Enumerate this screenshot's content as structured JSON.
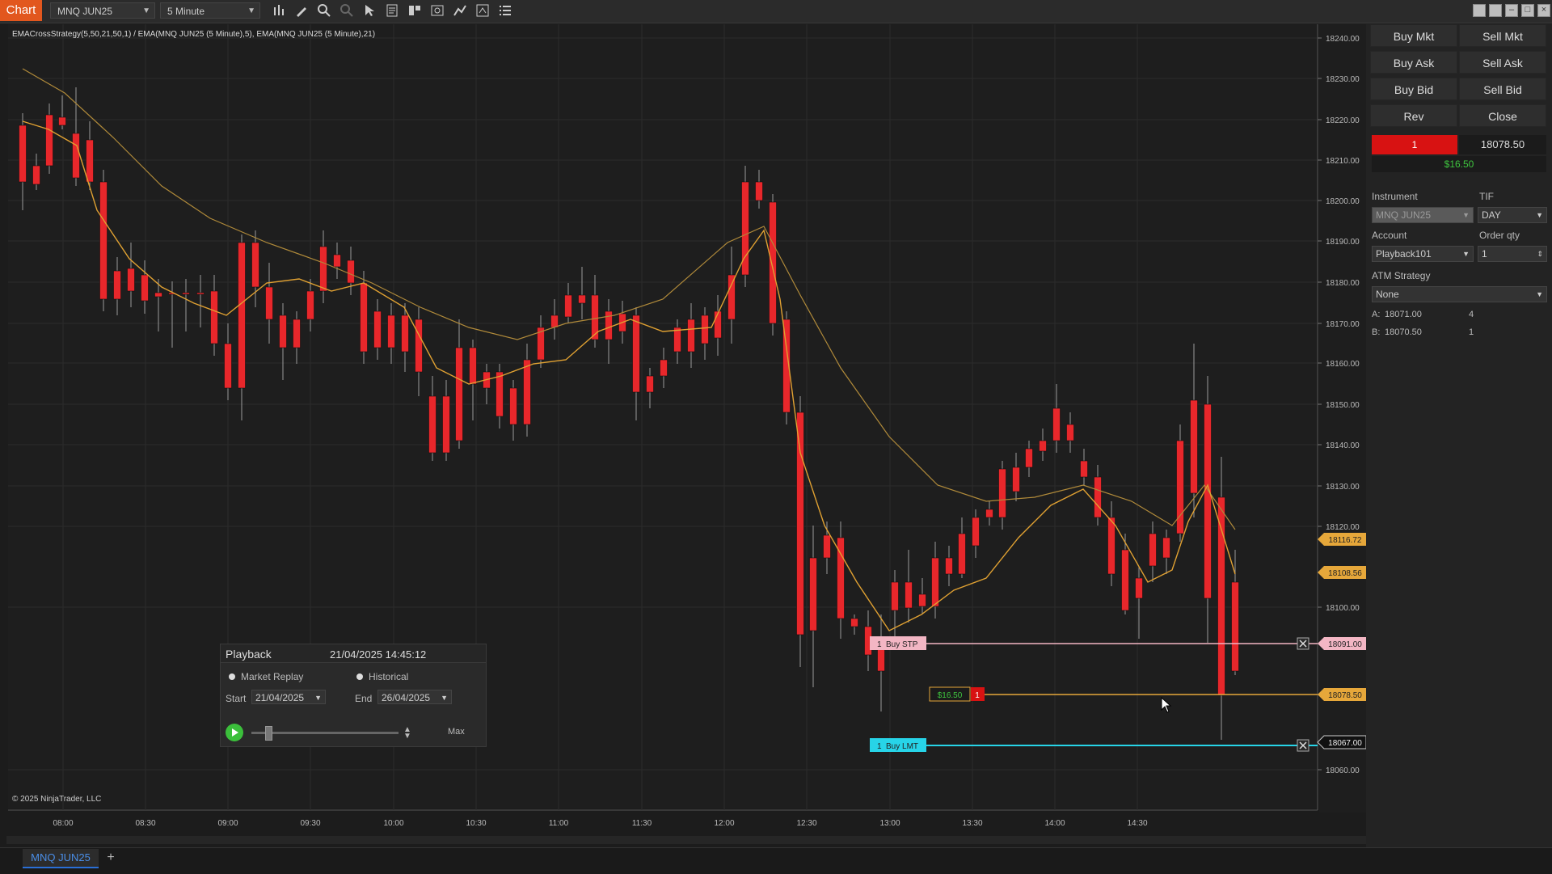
{
  "toolbar": {
    "chart_tab": "Chart",
    "instrument": "MNQ JUN25",
    "interval": "5 Minute"
  },
  "chart": {
    "strategy_label": "EMACrossStrategy(5,50,21,50,1) / EMA(MNQ JUN25 (5 Minute),5), EMA(MNQ JUN25 (5 Minute),21)",
    "copyright": "© 2025 NinjaTrader, LLC",
    "y_ticks": [
      "18240.00",
      "18230.00",
      "18220.00",
      "18210.00",
      "18200.00",
      "18190.00",
      "18180.00",
      "18170.00",
      "18160.00",
      "18150.00",
      "18140.00",
      "18130.00",
      "18120.00",
      "18100.00",
      "18060.00"
    ],
    "x_ticks": [
      "08:00",
      "08:30",
      "09:00",
      "09:30",
      "10:00",
      "10:30",
      "11:00",
      "11:30",
      "12:00",
      "12:30",
      "13:00",
      "13:30",
      "14:00",
      "14:30"
    ],
    "price_tags": [
      {
        "text": "18116.72",
        "bg": "#e6a73a",
        "fg": "#222"
      },
      {
        "text": "18108.56",
        "bg": "#e6a73a",
        "fg": "#222"
      },
      {
        "text": "18091.00",
        "bg": "#f3b6c4",
        "fg": "#222"
      },
      {
        "text": "18078.50",
        "bg": "#e6a73a",
        "fg": "#222"
      },
      {
        "text": "18067.00",
        "bg": "#111111",
        "fg": "#eee"
      }
    ],
    "orders": {
      "buy_stp_qty": "1",
      "buy_stp_label": "Buy STP",
      "buy_lmt_qty": "1",
      "buy_lmt_label": "Buy LMT",
      "position_pnl": "$16.50",
      "position_qty": "1"
    },
    "colors": {
      "up": "#3ec43e",
      "down": "#e8272b",
      "ema5": "#e0a132",
      "ema21": "#b08a3a",
      "buy_stp": "#f3b6c4",
      "buy_lmt": "#27d4e8",
      "position": "#e6a73a"
    }
  },
  "playback": {
    "title": "Playback",
    "time": "21/04/2025 14:45:12",
    "market_replay": "Market Replay",
    "historical": "Historical",
    "start_label": "Start",
    "start_value": "21/04/2025",
    "end_label": "End",
    "end_value": "26/04/2025",
    "max_label": "Max"
  },
  "order_panel": {
    "buy_mkt": "Buy Mkt",
    "sell_mkt": "Sell Mkt",
    "buy_ask": "Buy Ask",
    "sell_ask": "Sell Ask",
    "buy_bid": "Buy Bid",
    "sell_bid": "Sell Bid",
    "rev": "Rev",
    "close": "Close",
    "position_qty": "1",
    "avg_price": "18078.50",
    "unrealized": "$16.50",
    "instrument_label": "Instrument",
    "instrument_value": "MNQ JUN25",
    "tif_label": "TIF",
    "tif_value": "DAY",
    "account_label": "Account",
    "account_value": "Playback101",
    "order_qty_label": "Order qty",
    "order_qty_value": "1",
    "atm_label": "ATM Strategy",
    "atm_value": "None",
    "ask_label": "A:",
    "ask_price": "18071.00",
    "ask_size": "4",
    "bid_label": "B:",
    "bid_price": "18070.50",
    "bid_size": "1"
  },
  "tabs": {
    "active": "MNQ JUN25",
    "add": "+"
  }
}
